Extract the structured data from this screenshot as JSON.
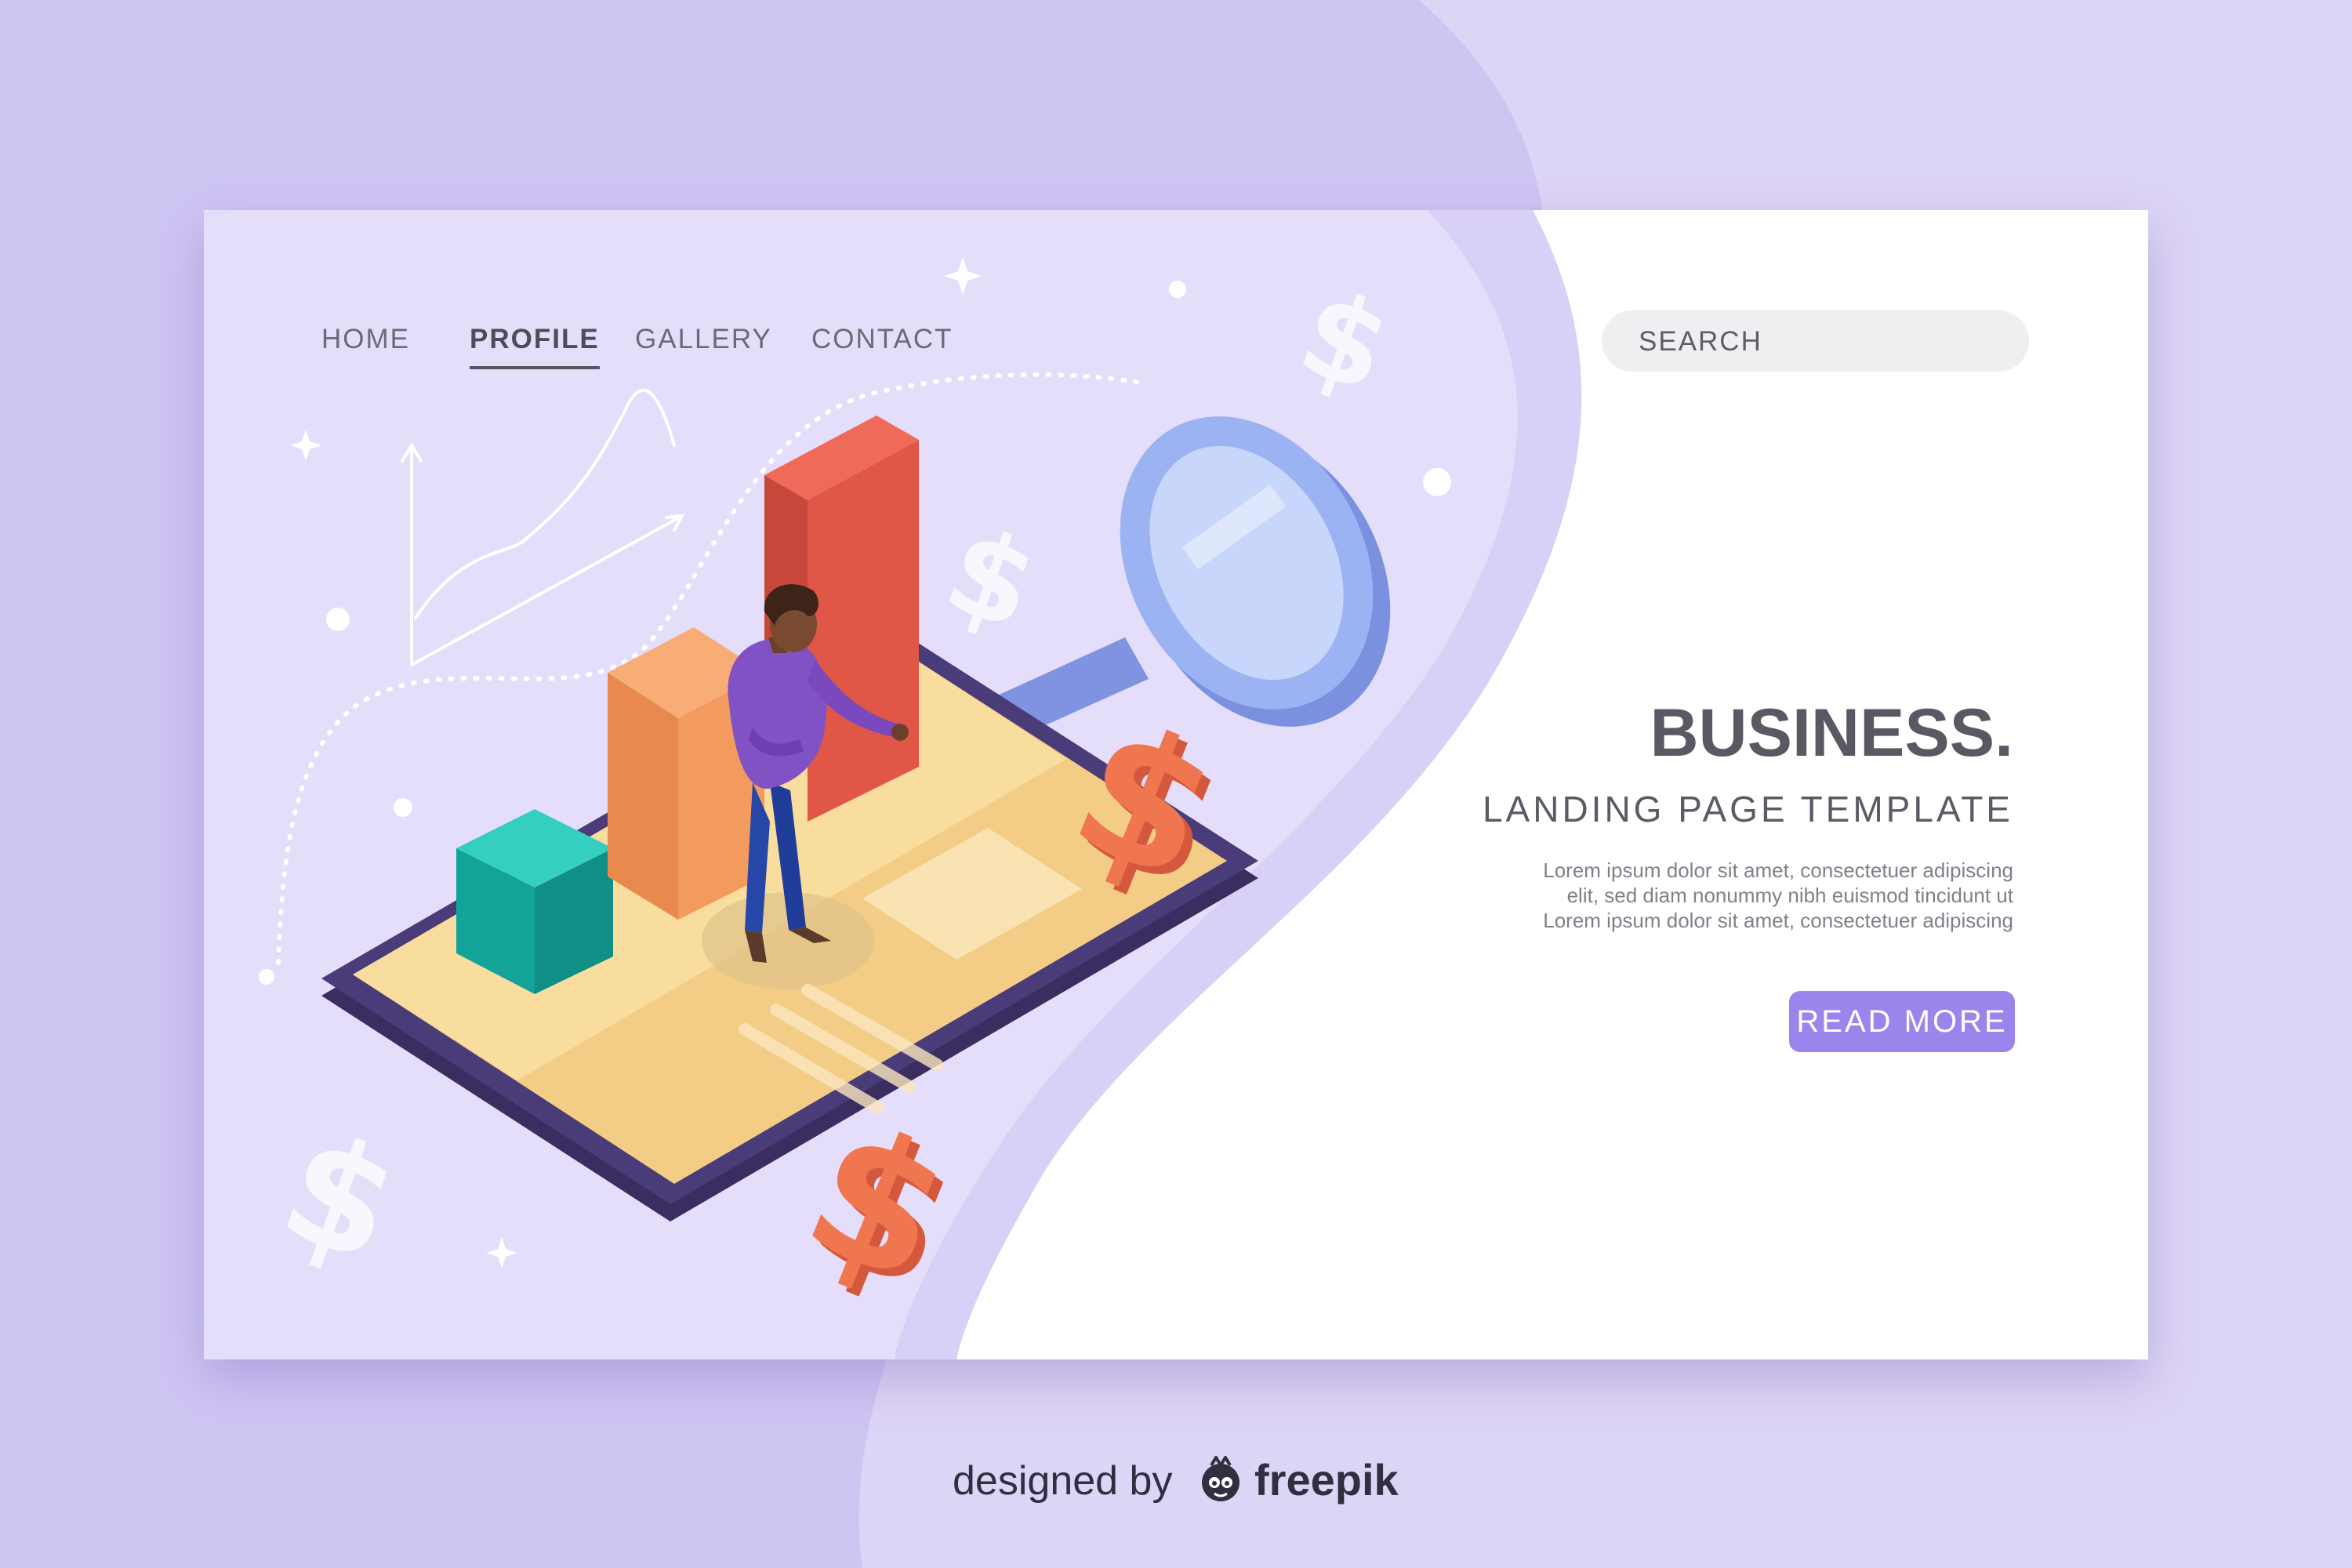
{
  "nav": {
    "items": [
      {
        "label": "HOME",
        "active": false
      },
      {
        "label": "PROFILE",
        "active": true
      },
      {
        "label": "GALLERY",
        "active": false
      },
      {
        "label": "CONTACT",
        "active": false
      }
    ]
  },
  "search": {
    "placeholder": "SEARCH"
  },
  "hero": {
    "title": "BUSINESS.",
    "subtitle": "LANDING PAGE TEMPLATE",
    "body_lines": [
      "Lorem ipsum dolor sit amet, consectetuer adipiscing",
      "elit, sed diam nonummy nibh euismod tincidunt ut",
      "Lorem ipsum dolor sit amet, consectetuer adipiscing"
    ],
    "cta_label": "READ MORE"
  },
  "footer": {
    "designed_by": "designed by",
    "brand": "freepik"
  },
  "illustration": {
    "currency_symbol": "$",
    "icons": [
      "magnifying-glass-icon",
      "bar-chart-icon",
      "dollar-sign-icon",
      "phone-icon",
      "person-icon",
      "line-chart-icon",
      "sparkle-icon"
    ]
  },
  "colors": {
    "outer_background": "#cfc5f3",
    "outer_wave": "#ddd5f6",
    "card_left": "#e5defa",
    "card_right": "#ffffff",
    "accent": "#9b84ec",
    "bar_teal": "#17b0a5",
    "bar_orange": "#f39458",
    "bar_red": "#e05647",
    "dollar_orange": "#f0764f",
    "lens_blue": "#8ea8f2",
    "phone_frame": "#45386b",
    "phone_screen": "#f6d693"
  }
}
